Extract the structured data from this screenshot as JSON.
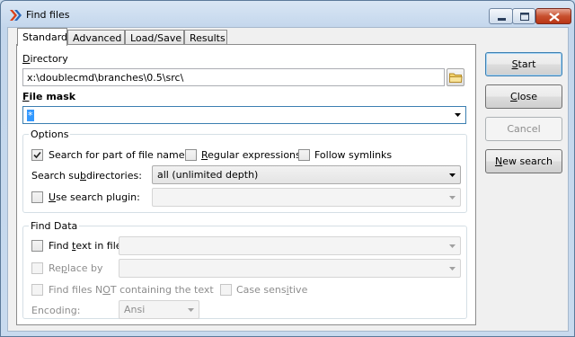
{
  "window": {
    "title": "Find files"
  },
  "tabs": [
    {
      "label": "Standard",
      "active": true
    },
    {
      "label": "Advanced",
      "active": false
    },
    {
      "label": "Load/Save",
      "active": false
    },
    {
      "label": "Results",
      "active": false
    }
  ],
  "directory": {
    "label_u": "D",
    "label_rest": "irectory",
    "value": "x:\\doublecmd\\branches\\0.5\\src\\"
  },
  "file_mask": {
    "label_u": "F",
    "label_rest": "ile mask",
    "value": "*"
  },
  "options": {
    "title": "Options",
    "search_part": {
      "label": "Search for part of file name",
      "checked": true
    },
    "regex": {
      "label_u": "R",
      "label_rest": "egular expressions",
      "checked": false
    },
    "symlinks": {
      "label": "Follow symlinks",
      "checked": false
    },
    "subdirs": {
      "label_pre": "Search su",
      "label_u": "b",
      "label_post": "directories:",
      "value": "all (unlimited depth)"
    },
    "plugin": {
      "label_u": "U",
      "label_rest": "se search plugin:",
      "checked": false,
      "value": ""
    }
  },
  "find_data": {
    "title": "Find Data",
    "find_text": {
      "label_pre": "Find ",
      "label_u": "t",
      "label_post": "ext in file",
      "checked": false,
      "value": ""
    },
    "replace": {
      "label_pre": "Re",
      "label_u": "p",
      "label_post": "lace by",
      "checked": false,
      "value": ""
    },
    "not_containing": {
      "label_pre": "Find files N",
      "label_u": "O",
      "label_post": "T containing the text",
      "checked": false
    },
    "case_sensitive": {
      "label_pre": "Case sens",
      "label_u": "i",
      "label_post": "tive",
      "checked": false
    },
    "encoding": {
      "label": "Encoding:",
      "value": "Ansi"
    }
  },
  "buttons": {
    "start": {
      "u": "S",
      "rest": "tart"
    },
    "close": {
      "u": "C",
      "rest": "lose"
    },
    "cancel": {
      "label": "Cancel"
    },
    "new_search": {
      "u": "N",
      "rest": "ew search"
    }
  },
  "colors": {
    "accent": "#3c7fb1",
    "disabled_text": "#8d8d8d",
    "close_button": "#c8502f"
  }
}
